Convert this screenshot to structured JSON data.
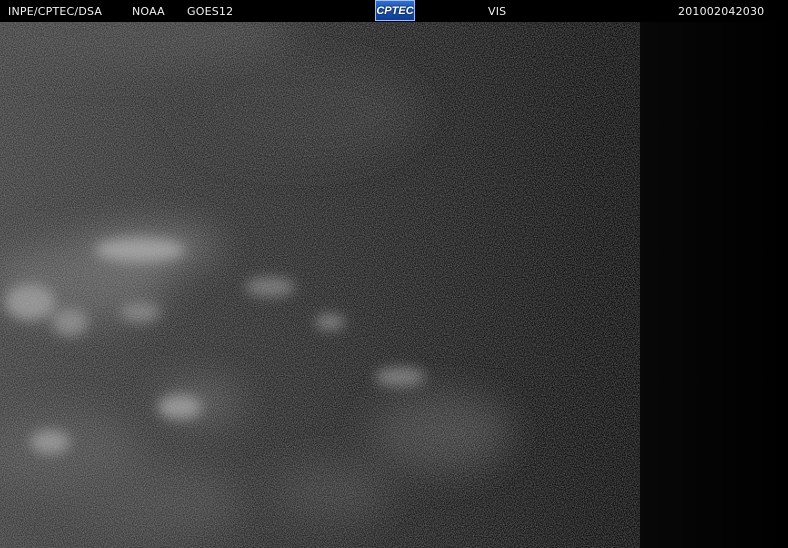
{
  "header": {
    "agency": "INPE/CPTEC/DSA",
    "source": "NOAA",
    "satellite": "GOES12",
    "logo_text": "CPTEC",
    "channel": "VIS",
    "timestamp": "201002042030"
  },
  "imagery": {
    "description_icon": "satellite-visible-image",
    "background_color": "#000000"
  }
}
